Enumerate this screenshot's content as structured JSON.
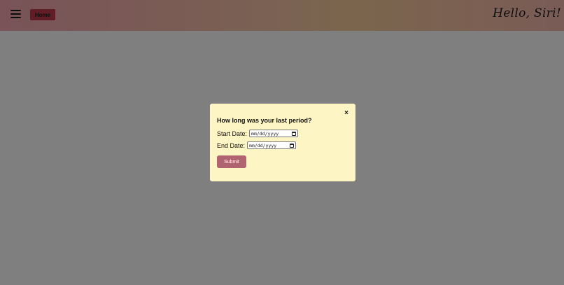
{
  "header": {
    "menu_icon": "hamburger-menu-icon",
    "home_label": "Home",
    "greeting": "Hello, Siri!"
  },
  "modal": {
    "close_label": "×",
    "title": "How long was your last period?",
    "start_label": "Start Date:",
    "start_placeholder": "mm/dd/yyyy",
    "end_label": "End Date:",
    "end_placeholder": "mm/dd/yyyy",
    "calendar_icon": "calendar-icon",
    "submit_label": "Submit"
  },
  "colors": {
    "header_gradient_start": "#f2a6b0",
    "header_gradient_end": "#f5b8ae",
    "home_button": "#c23a4d",
    "modal_background": "#fef5c4",
    "submit_button": "#b06470",
    "overlay": "rgba(0,0,0,0.5)"
  }
}
